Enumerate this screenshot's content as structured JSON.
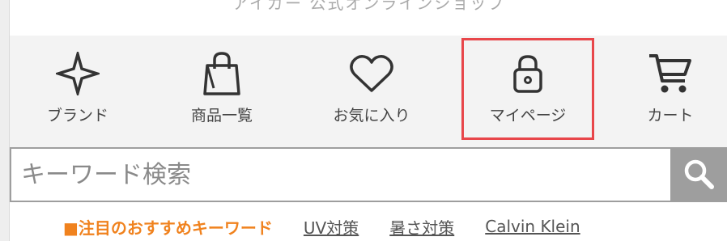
{
  "header": {
    "banner_text": "アイガー 公式オンラインショップ"
  },
  "nav": {
    "items": [
      {
        "label": "ブランド",
        "icon": "star-icon"
      },
      {
        "label": "商品一覧",
        "icon": "shopping-bag-icon"
      },
      {
        "label": "お気に入り",
        "icon": "heart-icon"
      },
      {
        "label": "マイページ",
        "icon": "lock-icon",
        "highlighted": true
      },
      {
        "label": "カート",
        "icon": "cart-icon"
      }
    ],
    "highlight_color": "#e8464a"
  },
  "search": {
    "placeholder": "キーワード検索",
    "value": "",
    "button_icon": "search-icon"
  },
  "keywords": {
    "title": "■注目のおすすめキーワード",
    "title_color": "#f0821e",
    "links": [
      "UV対策",
      "暑さ対策",
      "Calvin Klein"
    ]
  }
}
